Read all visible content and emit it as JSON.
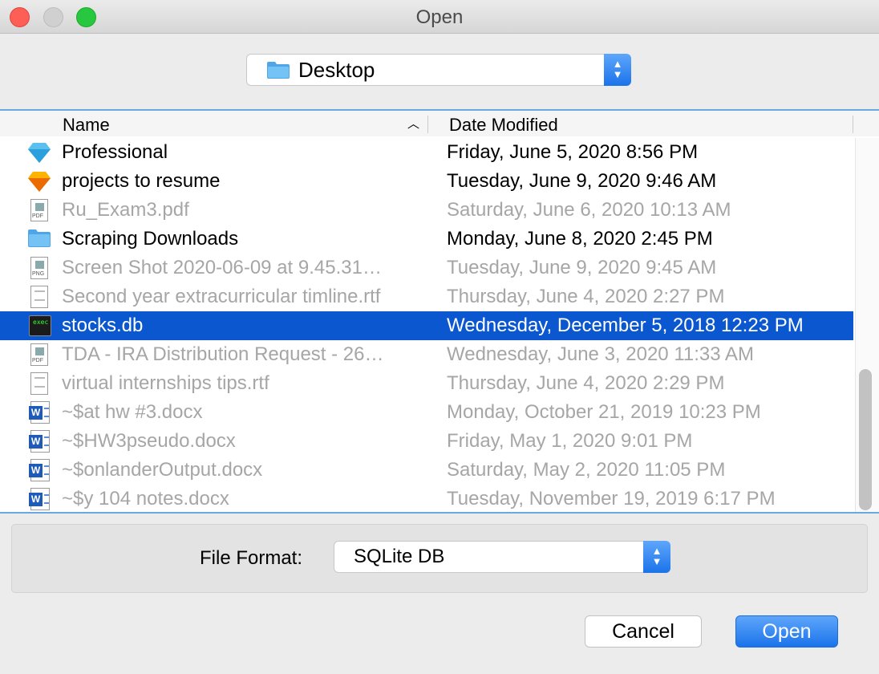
{
  "window": {
    "title": "Open"
  },
  "location": {
    "label": "Desktop",
    "icon": "folder-icon"
  },
  "columns": {
    "name": "Name",
    "date": "Date Modified",
    "sort_icon": "chevron-up-icon"
  },
  "files": [
    {
      "name": "Professional",
      "date": "Friday, June 5, 2020 8:56 PM",
      "icon": "sketch-blue-icon",
      "enabled": true
    },
    {
      "name": "projects to resume",
      "date": "Tuesday, June 9, 2020 9:46 AM",
      "icon": "sketch-orange-icon",
      "enabled": true
    },
    {
      "name": "Ru_Exam3.pdf",
      "date": "Saturday, June 6, 2020 10:13 AM",
      "icon": "pdf-icon",
      "enabled": false
    },
    {
      "name": "Scraping Downloads",
      "date": "Monday, June 8, 2020 2:45 PM",
      "icon": "folder-icon",
      "enabled": true
    },
    {
      "name": "Screen Shot 2020-06-09 at 9.45.31…",
      "date": "Tuesday, June 9, 2020 9:45 AM",
      "icon": "png-icon",
      "enabled": false
    },
    {
      "name": "Second year extracurricular timline.rtf",
      "date": "Thursday, June 4, 2020 2:27 PM",
      "icon": "rtf-icon",
      "enabled": false
    },
    {
      "name": "stocks.db",
      "date": "Wednesday, December 5, 2018 12:23 PM",
      "icon": "terminal-icon",
      "enabled": true,
      "selected": true
    },
    {
      "name": "TDA - IRA Distribution Request - 26…",
      "date": "Wednesday, June 3, 2020 11:33 AM",
      "icon": "pdf-icon",
      "enabled": false
    },
    {
      "name": "virtual internships tips.rtf",
      "date": "Thursday, June 4, 2020 2:29 PM",
      "icon": "rtf-icon",
      "enabled": false
    },
    {
      "name": "~$at hw #3.docx",
      "date": "Monday, October 21, 2019 10:23 PM",
      "icon": "word-doc-icon",
      "enabled": false
    },
    {
      "name": "~$HW3pseudo.docx",
      "date": "Friday, May 1, 2020 9:01 PM",
      "icon": "word-doc-icon",
      "enabled": false
    },
    {
      "name": "~$onlanderOutput.docx",
      "date": "Saturday, May 2, 2020 11:05 PM",
      "icon": "word-doc-icon",
      "enabled": false
    },
    {
      "name": "~$y 104 notes.docx",
      "date": "Tuesday, November 19, 2019 6:17 PM",
      "icon": "word-doc-icon",
      "enabled": false
    }
  ],
  "format": {
    "label": "File Format:",
    "value": "SQLite DB"
  },
  "buttons": {
    "cancel": "Cancel",
    "open": "Open"
  },
  "colors": {
    "accent": "#1b73ea",
    "selection": "#0b57d0",
    "close": "#fd5f57",
    "maximize": "#27c840"
  }
}
